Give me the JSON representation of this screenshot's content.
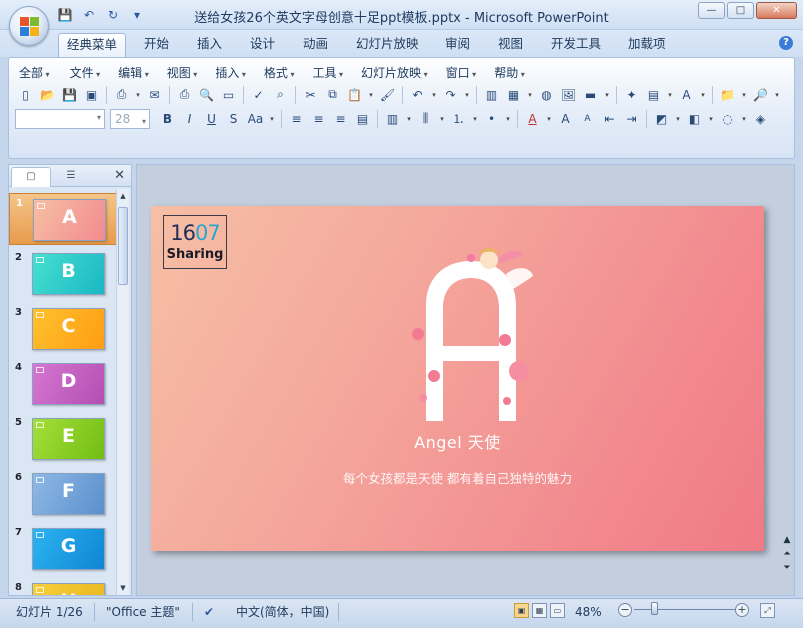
{
  "window": {
    "title": "送给女孩26个英文字母创意十足ppt模板.pptx - Microsoft PowerPoint",
    "controls": {
      "minimize": "—",
      "maximize": "□",
      "close": "✕"
    }
  },
  "quick_access": {
    "save": "💾",
    "undo": "↶",
    "redo": "↻",
    "customize": "▾"
  },
  "ribbon_tabs": [
    {
      "label": "经典菜单",
      "active": true
    },
    {
      "label": "开始"
    },
    {
      "label": "插入"
    },
    {
      "label": "设计"
    },
    {
      "label": "动画"
    },
    {
      "label": "幻灯片放映"
    },
    {
      "label": "审阅"
    },
    {
      "label": "视图"
    },
    {
      "label": "开发工具"
    },
    {
      "label": "加载项"
    }
  ],
  "classic_menu": [
    "全部",
    "文件",
    "编辑",
    "视图",
    "插入",
    "格式",
    "工具",
    "幻灯片放映",
    "窗口",
    "帮助"
  ],
  "formatting": {
    "font_name": "",
    "font_size": "28"
  },
  "slide_panel": {
    "tabs": [
      "▢",
      "☰"
    ],
    "close": "✕",
    "slides": [
      {
        "num": "1",
        "letter": "A",
        "selected": true,
        "color": "#f7a8a6"
      },
      {
        "num": "2",
        "letter": "B",
        "color": "#2fd3c9"
      },
      {
        "num": "3",
        "letter": "C",
        "color": "#ffb21f"
      },
      {
        "num": "4",
        "letter": "D",
        "color": "#c75fc4"
      },
      {
        "num": "5",
        "letter": "E",
        "color": "#8ed11a"
      },
      {
        "num": "6",
        "letter": "F",
        "color": "#6fa3d8"
      },
      {
        "num": "7",
        "letter": "G",
        "color": "#1fa0e6"
      },
      {
        "num": "8",
        "letter": "H",
        "color": "#f0c12a"
      }
    ]
  },
  "slide": {
    "brand_number_a": "16",
    "brand_number_b": "07",
    "brand_text": "Sharing",
    "big_letter": "A",
    "title": "Angel 天使",
    "subtitle": "每个女孩都是天使 都有着自己独特的魅力"
  },
  "status": {
    "slide_info": "幻灯片 1/26",
    "theme": "\"Office 主题\"",
    "language": "中文(简体，中国)",
    "zoom": "48%"
  },
  "colors": {
    "accent": "#f5a0a0",
    "selection": "#e79b4c"
  }
}
